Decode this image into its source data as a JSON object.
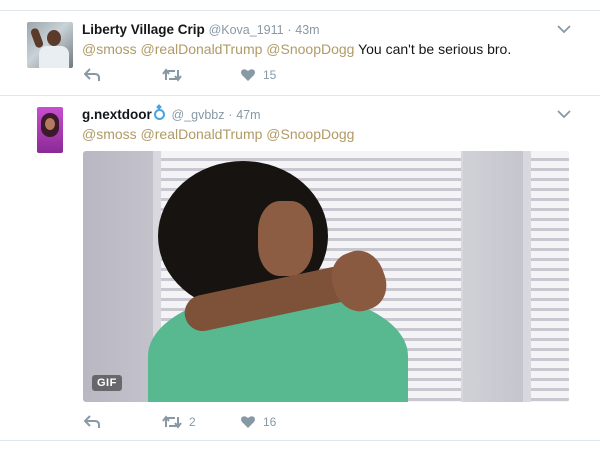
{
  "tweets": [
    {
      "name": "Liberty Village Crip",
      "handle": "@Kova_1911",
      "sep": "·",
      "time": "43m",
      "mentions": "@smoss @realDonaldTrump @SnoopDogg",
      "text": " You can't be serious bro.",
      "retweets": "",
      "likes": "15"
    },
    {
      "name": "g.nextdoor",
      "handle": "@_gvbbz",
      "sep": "·",
      "time": "47m",
      "mentions": "@smoss @realDonaldTrump @SnoopDogg",
      "text": "",
      "media_badge": "GIF",
      "retweets": "2",
      "likes": "16"
    }
  ],
  "colors": {
    "mention": "#b09a66",
    "muted": "#8899a6",
    "divider": "#e1e8ed",
    "name": "#14171a"
  },
  "icons": [
    "chevron-down-icon",
    "reply-icon",
    "retweet-icon",
    "like-icon",
    "verified-ring-icon"
  ]
}
